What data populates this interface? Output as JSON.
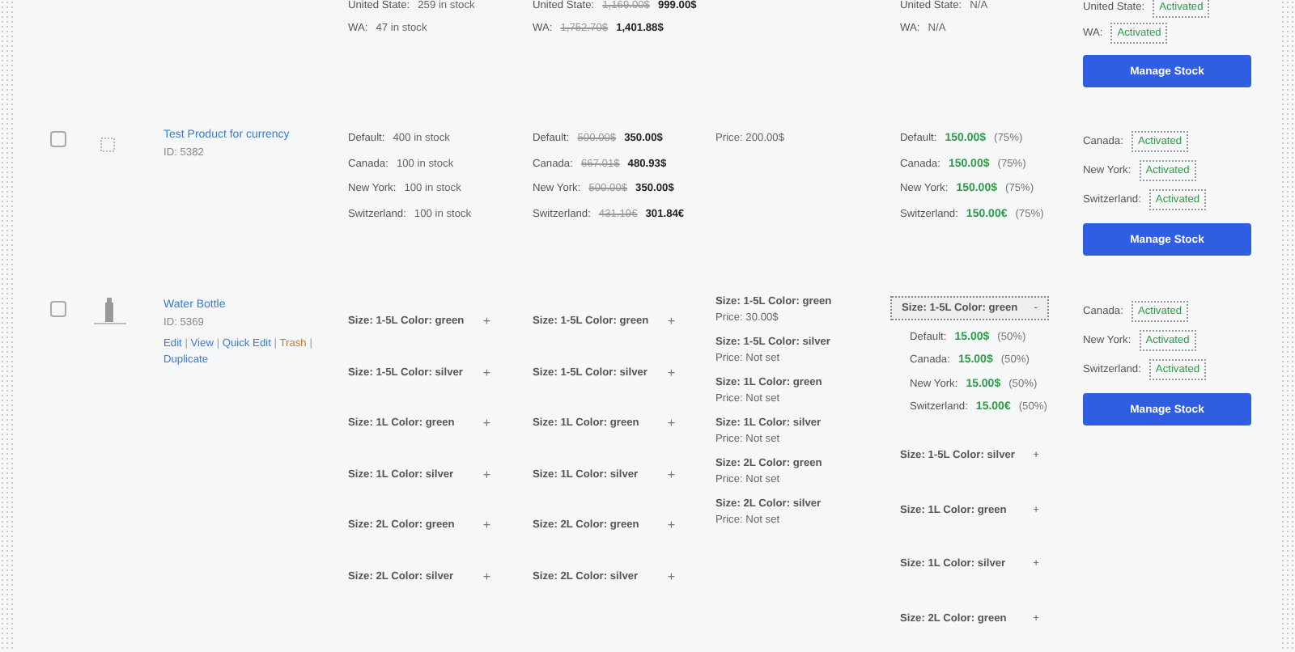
{
  "products": [
    {
      "kind": "simple",
      "stock": [
        {
          "location": "United State:",
          "value": "259 in stock"
        },
        {
          "location": "WA:",
          "value": "47 in stock"
        }
      ],
      "prices": [
        {
          "location": "United State:",
          "regular": "1,169.00$",
          "sale": "999.00$"
        },
        {
          "location": "WA:",
          "regular": "1,752.70$",
          "sale": "1,401.88$"
        }
      ],
      "discounts": [
        {
          "location": "United State:",
          "value": "N/A"
        },
        {
          "location": "WA:",
          "value": "N/A"
        }
      ],
      "status": [
        {
          "location": "United State:",
          "badge": "Activated"
        },
        {
          "location": "WA:",
          "badge": "Activated"
        }
      ],
      "button": "Manage Stock"
    },
    {
      "kind": "simple",
      "selected": false,
      "thumbnail": {
        "kind": "placeholder"
      },
      "name": "Test Product for currency",
      "product_id": "ID: 5382",
      "stock": [
        {
          "location": "Default:",
          "value": "400 in stock"
        },
        {
          "location": "Canada:",
          "value": "100 in stock"
        },
        {
          "location": "New York:",
          "value": "100 in stock"
        },
        {
          "location": "Switzerland:",
          "value": "100 in stock"
        }
      ],
      "prices": [
        {
          "location": "Default:",
          "regular": "500.00$",
          "sale": "350.00$"
        },
        {
          "location": "Canada:",
          "regular": "667.01$",
          "sale": "480.93$"
        },
        {
          "location": "New York:",
          "regular": "500.00$",
          "sale": "350.00$"
        },
        {
          "location": "Switzerland:",
          "regular": "431.19€",
          "sale": "301.84€"
        }
      ],
      "sale_price": "Price: 200.00$",
      "discounts": [
        {
          "location": "Default:",
          "value": "150.00$",
          "percent": "(75%)"
        },
        {
          "location": "Canada:",
          "value": "150.00$",
          "percent": "(75%)"
        },
        {
          "location": "New York:",
          "value": "150.00$",
          "percent": "(75%)"
        },
        {
          "location": "Switzerland:",
          "value": "150.00€",
          "percent": "(75%)"
        }
      ],
      "status": [
        {
          "location": "Canada:",
          "badge": "Activated"
        },
        {
          "location": "New York:",
          "badge": "Activated"
        },
        {
          "location": "Switzerland:",
          "badge": "Activated"
        }
      ],
      "button": "Manage Stock"
    },
    {
      "kind": "variable",
      "selected": false,
      "thumbnail": {
        "kind": "bottle"
      },
      "name": "Water Bottle",
      "product_id": "ID: 5369",
      "actions": [
        {
          "kind": "link",
          "label": "Edit",
          "danger": false
        },
        {
          "kind": "separator",
          "label": "|"
        },
        {
          "kind": "link",
          "label": "View",
          "danger": false
        },
        {
          "kind": "separator",
          "label": "|"
        },
        {
          "kind": "link",
          "label": "Quick Edit",
          "danger": false
        },
        {
          "kind": "separator",
          "label": "|"
        },
        {
          "kind": "link",
          "label": "Trash",
          "danger": true
        },
        {
          "kind": "separator",
          "label": "|"
        },
        {
          "kind": "link",
          "label": "Duplicate",
          "danger": false
        }
      ],
      "stock_variations": [
        {
          "label": "Size: 1-5L Color: green",
          "toggle": "+"
        },
        {
          "label": "Size: 1-5L Color: silver",
          "toggle": "+"
        },
        {
          "label": "Size: 1L Color: green",
          "toggle": "+"
        },
        {
          "label": "Size: 1L Color: silver",
          "toggle": "+"
        },
        {
          "label": "Size: 2L Color: green",
          "toggle": "+"
        },
        {
          "label": "Size: 2L Color: silver",
          "toggle": "+"
        }
      ],
      "price_variations": [
        {
          "label": "Size: 1-5L Color: green",
          "toggle": "+"
        },
        {
          "label": "Size: 1-5L Color: silver",
          "toggle": "+"
        },
        {
          "label": "Size: 1L Color: green",
          "toggle": "+"
        },
        {
          "label": "Size: 1L Color: silver",
          "toggle": "+"
        },
        {
          "label": "Size: 2L Color: green",
          "toggle": "+"
        },
        {
          "label": "Size: 2L Color: silver",
          "toggle": "+"
        }
      ],
      "sale_variations": [
        {
          "label": "Size: 1-5L Color: green",
          "price": "Price: 30.00$"
        },
        {
          "label": "Size: 1-5L Color: silver",
          "price": "Price: Not set"
        },
        {
          "label": "Size: 1L Color: green",
          "price": "Price: Not set"
        },
        {
          "label": "Size: 1L Color: silver",
          "price": "Price: Not set"
        },
        {
          "label": "Size: 2L Color: green",
          "price": "Price: Not set"
        },
        {
          "label": "Size: 2L Color: silver",
          "price": "Price: Not set"
        }
      ],
      "discount_variations": [
        {
          "label": "Size: 1-5L Color: green",
          "toggle": "-",
          "expanded": true,
          "details": [
            {
              "location": "Default:",
              "value": "15.00$",
              "percent": "(50%)"
            },
            {
              "location": "Canada:",
              "value": "15.00$",
              "percent": "(50%)"
            },
            {
              "location": "New York:",
              "value": "15.00$",
              "percent": "(50%)"
            },
            {
              "location": "Switzerland:",
              "value": "15.00€",
              "percent": "(50%)"
            }
          ]
        },
        {
          "label": "Size: 1-5L Color: silver",
          "toggle": "+",
          "expanded": false
        },
        {
          "label": "Size: 1L Color: green",
          "toggle": "+",
          "expanded": false
        },
        {
          "label": "Size: 1L Color: silver",
          "toggle": "+",
          "expanded": false
        },
        {
          "label": "Size: 2L Color: green",
          "toggle": "+",
          "expanded": false
        }
      ],
      "status": [
        {
          "location": "Canada:",
          "badge": "Activated"
        },
        {
          "location": "New York:",
          "badge": "Activated"
        },
        {
          "location": "Switzerland:",
          "badge": "Activated"
        }
      ],
      "button": "Manage Stock"
    }
  ]
}
